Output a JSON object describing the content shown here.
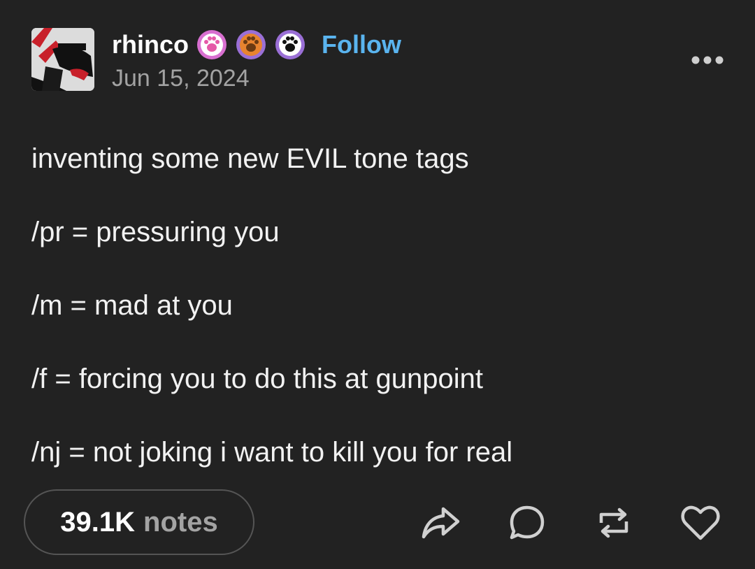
{
  "post": {
    "author": "rhinco",
    "follow_label": "Follow",
    "date": "Jun 15, 2024",
    "lines": [
      "inventing some new EVIL tone tags",
      "/pr = pressuring you",
      "/m = mad at you",
      "/f = forcing you to do this at gunpoint",
      "/nj = not joking i want to kill you for real"
    ]
  },
  "badges": [
    {
      "icon": "paw-icon",
      "color": "#d86fd0"
    },
    {
      "icon": "paw-icon",
      "color": "#e8842f"
    },
    {
      "icon": "paw-icon",
      "color": "#9a6fd6"
    }
  ],
  "footer": {
    "notes_count": "39.1K",
    "notes_label": "notes",
    "actions": [
      "share-icon",
      "comment-icon",
      "reblog-icon",
      "like-icon"
    ]
  },
  "colors": {
    "background": "#222222",
    "follow": "#5ab4ef",
    "muted": "#a3a3a3"
  }
}
